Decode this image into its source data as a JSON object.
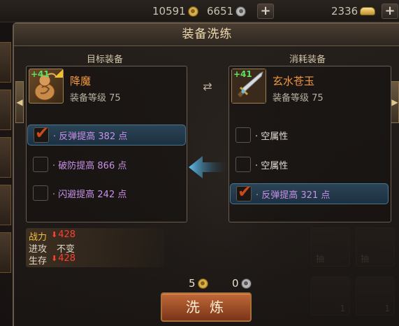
{
  "topbar": {
    "gold": "10591",
    "silver": "6651",
    "ingot": "2336",
    "plus_label": "+"
  },
  "panel": {
    "title": "装备洗练"
  },
  "target": {
    "label": "目标装备",
    "level_badge": "+41",
    "name": "降魔",
    "level_text": "装备等级 75",
    "attributes": [
      {
        "text": "· 反弹提高 382 点",
        "checked": true
      },
      {
        "text": "· 破防提高 866 点",
        "checked": false
      },
      {
        "text": "· 闪避提高 242 点",
        "checked": false
      }
    ]
  },
  "consume": {
    "label": "消耗装备",
    "level_badge": "+41",
    "name": "玄水苍玉",
    "level_text": "装备等级 75",
    "attributes": [
      {
        "text": "· 空属性",
        "checked": false
      },
      {
        "text": "· 空属性",
        "checked": false
      },
      {
        "text": "· 反弹提高 321 点",
        "checked": true
      }
    ]
  },
  "stats": {
    "power_label": "战力",
    "power_value": "428",
    "attack_label": "进攻",
    "attack_value": "不变",
    "survive_label": "生存",
    "survive_value": "428"
  },
  "cost": {
    "gold": "5",
    "silver": "0"
  },
  "refine_button": "洗 炼",
  "bg_slots": {
    "slot1": "抽",
    "slot2": "抽",
    "slot3": "1",
    "slot4": "1"
  },
  "colors": {
    "accent_orange": "#f09840",
    "attr_purple": "#c890e8",
    "selected_blue": "#4a7690",
    "stat_down_red": "#ff4030"
  }
}
